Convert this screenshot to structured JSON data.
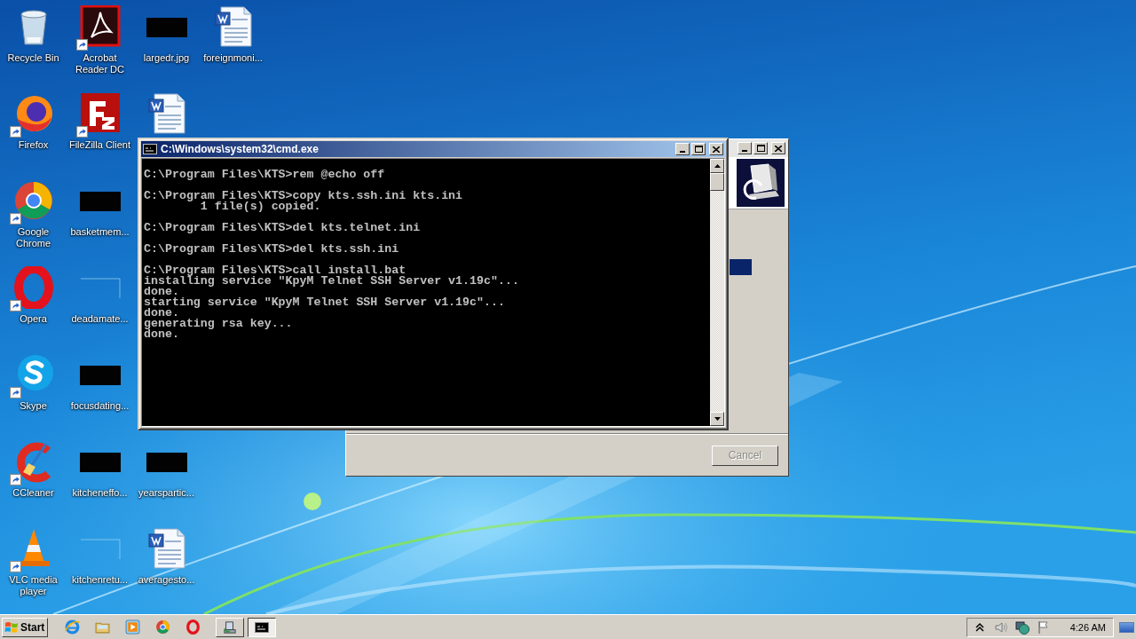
{
  "desktop": {
    "rows": [
      {
        "icons": [
          {
            "label": "Recycle Bin",
            "kind": "recycle-bin",
            "shortcut": false
          },
          {
            "label": "Acrobat Reader DC",
            "kind": "acrobat",
            "shortcut": true
          },
          {
            "label": "largedr.jpg",
            "kind": "dark-thumb",
            "shortcut": false
          },
          {
            "label": "foreignmoni...",
            "kind": "word-doc",
            "shortcut": false
          }
        ]
      },
      {
        "icons": [
          {
            "label": "Firefox",
            "kind": "firefox",
            "shortcut": true
          },
          {
            "label": "FileZilla Client",
            "kind": "filezilla",
            "shortcut": true
          },
          {
            "kind": "word-doc",
            "shortcut": false
          }
        ]
      },
      {
        "icons": [
          {
            "label": "Google Chrome",
            "kind": "chrome",
            "shortcut": true
          },
          {
            "label": "basketmem...",
            "kind": "dark-thumb",
            "shortcut": false
          }
        ]
      },
      {
        "icons": [
          {
            "label": "Opera",
            "kind": "opera",
            "shortcut": true
          },
          {
            "label": "deadamate...",
            "kind": "blank-thumb",
            "shortcut": false
          }
        ]
      },
      {
        "icons": [
          {
            "label": "Skype",
            "kind": "skype",
            "shortcut": true
          },
          {
            "label": "focusdating...",
            "kind": "dark-thumb",
            "shortcut": false
          }
        ]
      },
      {
        "icons": [
          {
            "label": "CCleaner",
            "kind": "ccleaner",
            "shortcut": true
          },
          {
            "label": "kitcheneffo...",
            "kind": "dark-thumb",
            "shortcut": false
          },
          {
            "label": "yearspartic...",
            "kind": "dark-thumb",
            "shortcut": false
          }
        ]
      },
      {
        "icons": [
          {
            "label": "VLC media player",
            "kind": "vlc",
            "shortcut": true
          },
          {
            "label": "kitchenretu...",
            "kind": "blank-thumb",
            "shortcut": false
          },
          {
            "label": "averagesto...",
            "kind": "word-doc",
            "shortcut": false
          }
        ]
      }
    ]
  },
  "installer_window": {
    "active": false,
    "cancel_button": {
      "label": "Cancel",
      "disabled": true
    }
  },
  "console_window": {
    "title": "C:\\Windows\\system32\\cmd.exe",
    "active": true,
    "blocks": [
      {
        "lines": [
          "C:\\Program Files\\KTS>rem @echo off"
        ]
      },
      {
        "lines": [
          "C:\\Program Files\\KTS>copy kts.ssh.ini kts.ini",
          "        1 file(s) copied."
        ]
      },
      {
        "lines": [
          "C:\\Program Files\\KTS>del kts.telnet.ini"
        ]
      },
      {
        "lines": [
          "C:\\Program Files\\KTS>del kts.ssh.ini"
        ]
      },
      {
        "lines": [
          "C:\\Program Files\\KTS>call install.bat",
          "installing service \"KpyM Telnet SSH Server v1.19c\"...",
          "done.",
          "starting service \"KpyM Telnet SSH Server v1.19c\"...",
          "done.",
          "generating rsa key...",
          "done."
        ]
      }
    ]
  },
  "taskbar": {
    "start_label": "Start",
    "quick_launch": [
      {
        "kind": "ie"
      },
      {
        "kind": "folder"
      },
      {
        "kind": "media-player"
      },
      {
        "kind": "chrome"
      },
      {
        "kind": "opera"
      }
    ],
    "tasks": [
      {
        "kind": "installer",
        "selected": false
      },
      {
        "kind": "console",
        "selected": true
      }
    ],
    "tray_icons": [
      {
        "kind": "expand"
      },
      {
        "kind": "speaker"
      },
      {
        "kind": "network"
      },
      {
        "kind": "flag"
      }
    ],
    "clock": "4:26 AM"
  }
}
